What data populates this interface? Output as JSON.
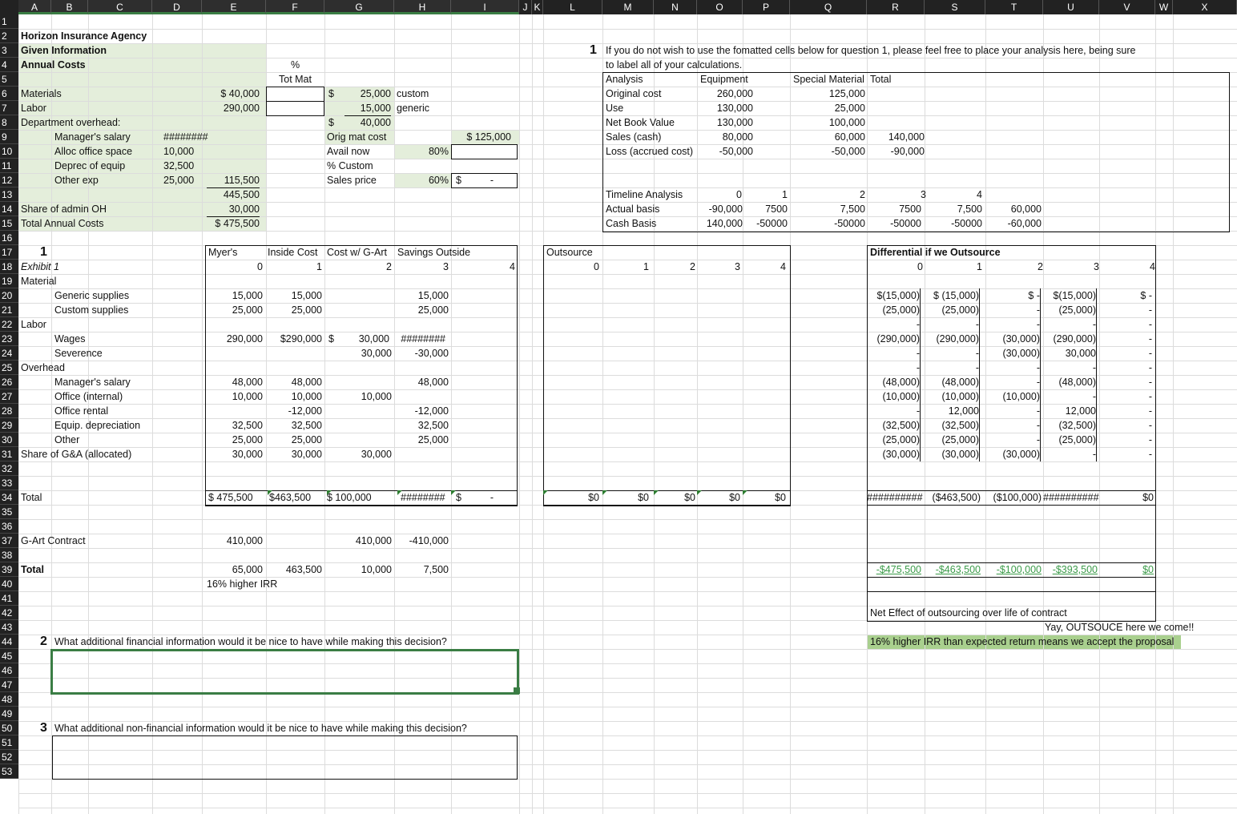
{
  "columns": [
    "A",
    "B",
    "C",
    "D",
    "E",
    "F",
    "G",
    "H",
    "I",
    "J",
    "K",
    "L",
    "M",
    "N",
    "O",
    "P",
    "Q",
    "R",
    "S",
    "T",
    "U",
    "V",
    "W",
    "X"
  ],
  "rows": [
    "1",
    "2",
    "3",
    "4",
    "5",
    "6",
    "7",
    "8",
    "9",
    "10",
    "11",
    "12",
    "13",
    "14",
    "15",
    "16",
    "17",
    "18",
    "19",
    "20",
    "21",
    "22",
    "23",
    "24",
    "25",
    "26",
    "27",
    "28",
    "29",
    "30",
    "31",
    "32",
    "33",
    "34",
    "35",
    "36",
    "37",
    "38",
    "39",
    "40",
    "41",
    "42",
    "43",
    "44",
    "45",
    "46",
    "47",
    "48",
    "49",
    "50",
    "51",
    "52",
    "53"
  ],
  "colors": {
    "header_bg": "#222222",
    "grid": "#dcdcdc",
    "given_fill": "#e4eedb",
    "green_fill": "#a9d08e",
    "green_text": "#3b9b49",
    "select_border": "#3a7d44"
  },
  "given": {
    "title": "Horizon Insurance Agency",
    "subtitle": "Given Information",
    "annual_costs": "Annual Costs",
    "pct_label": "%",
    "tot_mat_label": "Tot Mat",
    "materials": "Materials",
    "labor": "Labor",
    "dept_overhead": "Department overhead:",
    "managers_salary": "Manager's salary",
    "alloc_office": "Alloc office space",
    "deprec_equip": "Deprec of equip",
    "other_exp": "Other exp",
    "share_admin": "Share of admin OH",
    "total_annual": "Total Annual Costs",
    "materials_val": "$ 40,000",
    "labor_val": "290,000",
    "managers_salary_val": "########",
    "alloc_office_val": "10,000",
    "deprec_equip_val": "32,500",
    "other_exp_val": "25,000",
    "overhead_subtotal": "115,500",
    "subtotal": "445,500",
    "share_admin_val": "30,000",
    "total_annual_val": "$ 475,500",
    "custom_dollar": "$",
    "custom_val": "25,000",
    "custom_label": "custom",
    "generic_val": "15,000",
    "generic_label": "generic",
    "mat_total_dollar": "$",
    "mat_total_val": "40,000",
    "orig_mat_cost": "Orig mat cost",
    "orig_mat_cost_val": "$ 125,000",
    "avail_now": "Avail now",
    "avail_now_pct": "80%",
    "pct_custom": "% Custom",
    "sales_price": "Sales price",
    "sales_price_pct": "60%",
    "sales_price_dollar": "$",
    "sales_price_dash": "-"
  },
  "question1": {
    "number": "1",
    "text_line1": "If you do not wish to use the fomatted cells below for question 1, please feel free to place your analysis here, being sure",
    "text_line2": "to label all of your calculations."
  },
  "analysis": {
    "headers": [
      "Analysis",
      "Equipment",
      "Special Material",
      "Total"
    ],
    "rows": [
      [
        "Original cost",
        "260,000",
        "125,000",
        ""
      ],
      [
        "Use",
        "130,000",
        "25,000",
        ""
      ],
      [
        "Net Book Value",
        "130,000",
        "100,000",
        ""
      ],
      [
        "Sales (cash)",
        "80,000",
        "60,000",
        "140,000"
      ],
      [
        "Loss (accrued cost)",
        "-50,000",
        "-50,000",
        "-90,000"
      ]
    ],
    "timeline_label": "Timeline Analysis",
    "timeline_years": [
      "0",
      "1",
      "2",
      "3",
      "4"
    ],
    "actual_label": "Actual basis",
    "actual_vals": [
      "-90,000",
      "7500",
      "7,500",
      "7500",
      "7,500",
      "60,000"
    ],
    "cash_label": "Cash Basis",
    "cash_vals": [
      "140,000",
      "-50000",
      "-50000",
      "-50000",
      "-50000",
      "-60,000"
    ]
  },
  "exhibit": {
    "number": "1",
    "title": "Exhibit 1",
    "headers": [
      "Myer's",
      "Inside Cost",
      "Cost w/ G-Art",
      "Savings Outside"
    ],
    "years": [
      "0",
      "1",
      "2",
      "3",
      "4"
    ],
    "material": "Material",
    "generic": "Generic supplies",
    "custom": "Custom supplies",
    "labor": "Labor",
    "wages": "Wages",
    "severence": "Severence",
    "overhead": "Overhead",
    "mgr_salary": "Manager's salary",
    "office_internal": "Office (internal)",
    "office_rental": "Office rental",
    "equip_dep": "Equip. depreciation",
    "other": "Other",
    "share_ga": "Share of G&A (allocated)",
    "total": "Total",
    "gart": "G-Art Contract",
    "total2": "Total",
    "irr": "16% higher IRR",
    "generic_vals": [
      "15,000",
      "15,000",
      "",
      "15,000"
    ],
    "custom_vals": [
      "25,000",
      "25,000",
      "",
      "25,000"
    ],
    "wages_vals": [
      "290,000",
      "$290,000",
      "$",
      "30,000",
      "########"
    ],
    "severence_vals": [
      "30,000",
      "-30,000"
    ],
    "mgr_vals": [
      "48,000",
      "48,000",
      "",
      "48,000"
    ],
    "office_int_vals": [
      "10,000",
      "10,000",
      "10,000"
    ],
    "office_rent_vals": [
      "-12,000",
      "-12,000"
    ],
    "equip_vals": [
      "32,500",
      "32,500",
      "32,500"
    ],
    "other_vals": [
      "25,000",
      "25,000",
      "25,000"
    ],
    "share_vals": [
      "30,000",
      "30,000",
      "30,000"
    ],
    "total_vals": [
      "$ 475,500",
      "$463,500",
      "$ 100,000",
      "########",
      "$",
      "-"
    ],
    "gart_vals": [
      "410,000",
      "410,000",
      "-410,000"
    ],
    "total2_vals": [
      "65,000",
      "463,500",
      "10,000",
      "7,500"
    ]
  },
  "outsource": {
    "title": "Outsource",
    "years": [
      "0",
      "1",
      "2",
      "3",
      "4"
    ],
    "totals": [
      "$0",
      "$0",
      "$0",
      "$0",
      "$0"
    ]
  },
  "differential": {
    "title": "Differential if we Outsource",
    "years": [
      "0",
      "1",
      "2",
      "3",
      "4"
    ],
    "rows": [
      [
        "$(15,000)",
        "$ (15,000)",
        "$        -",
        "$(15,000)",
        "$        -"
      ],
      [
        "(25,000)",
        "(25,000)",
        "-",
        "(25,000)",
        "-"
      ],
      [
        "-",
        "-",
        "-",
        "-",
        "-"
      ],
      [
        "(290,000)",
        "(290,000)",
        "(30,000)",
        "(290,000)",
        "-"
      ],
      [
        "-",
        "-",
        "(30,000)",
        "30,000",
        "-"
      ],
      [
        "-",
        "-",
        "-",
        "-",
        "-"
      ],
      [
        "(48,000)",
        "(48,000)",
        "-",
        "(48,000)",
        "-"
      ],
      [
        "(10,000)",
        "(10,000)",
        "(10,000)",
        "-",
        "-"
      ],
      [
        "-",
        "12,000",
        "-",
        "12,000",
        "-"
      ],
      [
        "(32,500)",
        "(32,500)",
        "-",
        "(32,500)",
        "-"
      ],
      [
        "(25,000)",
        "(25,000)",
        "-",
        "(25,000)",
        "-"
      ],
      [
        "(30,000)",
        "(30,000)",
        "(30,000)",
        "-",
        "-"
      ]
    ],
    "totals": [
      "##########",
      "($463,500)",
      "($100,000)",
      "##########",
      "$0"
    ],
    "green_totals": [
      "-$475,500",
      "-$463,500",
      "-$100,000",
      "-$393,500",
      "$0"
    ],
    "net_effect": "Net Effect of outsourcing over life of contract",
    "yay": "Yay, OUTSOUCE here we come!!",
    "irr_note": "16% higher IRR than expected return means we accept the proposal"
  },
  "question2": {
    "number": "2",
    "text": "What additional financial information would it be nice to have while making this decision?"
  },
  "question3": {
    "number": "3",
    "text": "What additional non-financial information would it be nice to have while making this decision?"
  }
}
